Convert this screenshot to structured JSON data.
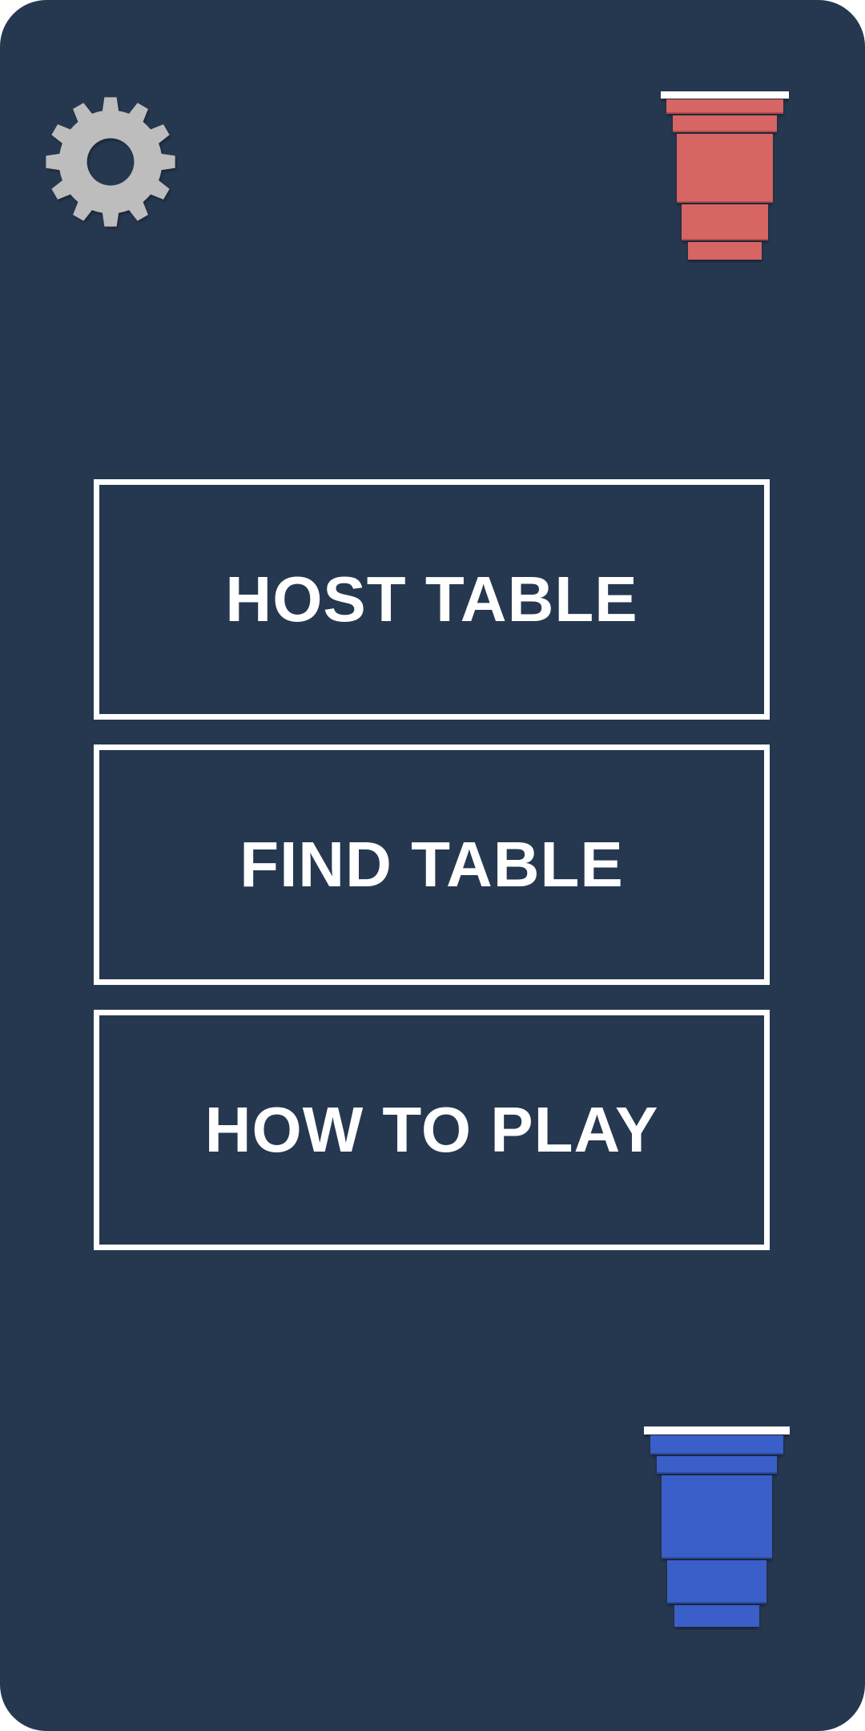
{
  "menu": {
    "host_label": "HOST TABLE",
    "find_label": "FIND TABLE",
    "how_label": "HOW TO PLAY"
  },
  "icons": {
    "settings": "gear-icon",
    "team_one": "red-cup-icon",
    "team_two": "blue-cup-icon"
  },
  "colors": {
    "background": "#263850",
    "button_border": "#ffffff",
    "button_text": "#ffffff",
    "gear": "#bdbdbd",
    "red_cup": "#d66563",
    "blue_cup": "#3a5fc8"
  }
}
